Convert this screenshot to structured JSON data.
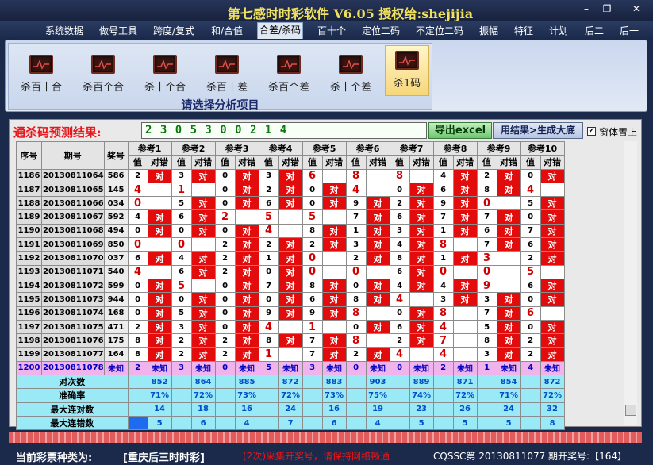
{
  "window": {
    "title": "第七感时时彩软件   V6.05  授权给:shejijia"
  },
  "menu": [
    "系统数据",
    "做号工具",
    "跨度/复式",
    "和/合值",
    "合差/杀码",
    "百十个",
    "定位二码",
    "不定位二码",
    "振幅",
    "特征",
    "计划",
    "后二",
    "后一"
  ],
  "tools": {
    "items": [
      "杀百十合",
      "杀百个合",
      "杀十个合",
      "杀百十差",
      "杀百个差",
      "杀十个差",
      "杀1码"
    ],
    "caption": "请选择分析项目"
  },
  "result": {
    "label": "通杀码预测结果:",
    "value": "2 3 0 5 3 0 0 2 1 4",
    "export_label": "导出excel",
    "generate_label": "用结果>生成大底",
    "topmost_label": "窗体置上"
  },
  "table": {
    "col_headers": [
      "序号",
      "期号",
      "奖号"
    ],
    "ref_headers": [
      "参考1",
      "参考2",
      "参考3",
      "参考4",
      "参考5",
      "参考6",
      "参考7",
      "参考8",
      "参考9",
      "参考10"
    ],
    "sub_headers": [
      "值",
      "对错"
    ],
    "rows": [
      {
        "seq": "1186",
        "period": "20130811064",
        "prize": "586",
        "vals": [
          "2",
          "3",
          "0",
          "3",
          "6",
          "8",
          "8",
          "4",
          "2",
          "0"
        ],
        "marks": [
          "对",
          "对",
          "对",
          "对",
          "",
          "",
          "",
          "对",
          "对",
          "对"
        ]
      },
      {
        "seq": "1187",
        "period": "20130811065",
        "prize": "145",
        "vals": [
          "4",
          "1",
          "0",
          "2",
          "0",
          "4",
          "0",
          "6",
          "8",
          "4"
        ],
        "marks": [
          "",
          "",
          "对",
          "对",
          "对",
          "",
          "对",
          "对",
          "对",
          ""
        ]
      },
      {
        "seq": "1188",
        "period": "20130811066",
        "prize": "034",
        "vals": [
          "0",
          "5",
          "0",
          "6",
          "0",
          "9",
          "2",
          "9",
          "0",
          "5"
        ],
        "marks": [
          "",
          "对",
          "对",
          "对",
          "对",
          "对",
          "对",
          "对",
          "",
          "对"
        ]
      },
      {
        "seq": "1189",
        "period": "20130811067",
        "prize": "592",
        "vals": [
          "4",
          "6",
          "2",
          "5",
          "5",
          "7",
          "6",
          "7",
          "7",
          "0"
        ],
        "marks": [
          "对",
          "对",
          "",
          "",
          "",
          "对",
          "对",
          "对",
          "对",
          "对"
        ]
      },
      {
        "seq": "1190",
        "period": "20130811068",
        "prize": "494",
        "vals": [
          "0",
          "0",
          "0",
          "4",
          "8",
          "1",
          "3",
          "1",
          "6",
          "7"
        ],
        "marks": [
          "对",
          "对",
          "对",
          "",
          "对",
          "对",
          "对",
          "对",
          "对",
          "对"
        ]
      },
      {
        "seq": "1191",
        "period": "20130811069",
        "prize": "850",
        "vals": [
          "0",
          "0",
          "2",
          "2",
          "2",
          "3",
          "4",
          "8",
          "7",
          "6"
        ],
        "marks": [
          "",
          "",
          "对",
          "对",
          "对",
          "对",
          "对",
          "",
          "对",
          "对"
        ]
      },
      {
        "seq": "1192",
        "period": "20130811070",
        "prize": "037",
        "vals": [
          "6",
          "4",
          "2",
          "1",
          "0",
          "2",
          "8",
          "1",
          "3",
          "2"
        ],
        "marks": [
          "对",
          "对",
          "对",
          "对",
          "",
          "对",
          "对",
          "对",
          "",
          "对"
        ]
      },
      {
        "seq": "1193",
        "period": "20130811071",
        "prize": "540",
        "vals": [
          "4",
          "6",
          "2",
          "0",
          "0",
          "0",
          "6",
          "0",
          "0",
          "5"
        ],
        "marks": [
          "",
          "对",
          "对",
          "对",
          "",
          "",
          "对",
          "",
          "",
          ""
        ]
      },
      {
        "seq": "1194",
        "period": "20130811072",
        "prize": "599",
        "vals": [
          "0",
          "5",
          "0",
          "7",
          "8",
          "0",
          "4",
          "4",
          "9",
          "6"
        ],
        "marks": [
          "对",
          "",
          "对",
          "对",
          "对",
          "对",
          "对",
          "对",
          "",
          "对"
        ]
      },
      {
        "seq": "1195",
        "period": "20130811073",
        "prize": "944",
        "vals": [
          "0",
          "0",
          "0",
          "0",
          "6",
          "8",
          "4",
          "3",
          "3",
          "0"
        ],
        "marks": [
          "对",
          "对",
          "对",
          "对",
          "对",
          "对",
          "",
          "对",
          "对",
          "对"
        ]
      },
      {
        "seq": "1196",
        "period": "20130811074",
        "prize": "168",
        "vals": [
          "0",
          "5",
          "0",
          "9",
          "9",
          "8",
          "0",
          "8",
          "7",
          "6"
        ],
        "marks": [
          "对",
          "对",
          "对",
          "对",
          "对",
          "",
          "对",
          "",
          "对",
          ""
        ]
      },
      {
        "seq": "1197",
        "period": "20130811075",
        "prize": "471",
        "vals": [
          "2",
          "3",
          "0",
          "4",
          "1",
          "0",
          "6",
          "4",
          "5",
          "0"
        ],
        "marks": [
          "对",
          "对",
          "对",
          "",
          "",
          "对",
          "对",
          "",
          "对",
          "对"
        ]
      },
      {
        "seq": "1198",
        "period": "20130811076",
        "prize": "175",
        "prize_note": "",
        "vals": [
          "8",
          "2",
          "2",
          "8",
          "7",
          "8",
          "2",
          "7",
          "8",
          "2"
        ],
        "marks": [
          "对",
          "对",
          "对",
          "对",
          "对",
          "",
          "对",
          "",
          "对",
          "对"
        ]
      },
      {
        "seq": "1199",
        "period": "20130811077",
        "prize": "164",
        "vals": [
          "8",
          "2",
          "2",
          "1",
          "7",
          "2",
          "4",
          "4",
          "3",
          "2"
        ],
        "marks": [
          "对",
          "对",
          "对",
          "",
          "对",
          "对",
          "",
          "",
          "对",
          "对"
        ]
      },
      {
        "seq": "1200",
        "period": "20130811078",
        "prize": "未知",
        "vals": [
          "2",
          "3",
          "0",
          "5",
          "3",
          "0",
          "0",
          "2",
          "1",
          "4"
        ],
        "marks": [
          "未知",
          "未知",
          "未知",
          "未知",
          "未知",
          "未知",
          "未知",
          "未知",
          "未知",
          "未知"
        ]
      }
    ],
    "stats": [
      {
        "label": "对次数",
        "values": [
          "852",
          "864",
          "885",
          "872",
          "883",
          "903",
          "889",
          "871",
          "854",
          "872"
        ]
      },
      {
        "label": "准确率",
        "values": [
          "71%",
          "72%",
          "73%",
          "72%",
          "73%",
          "75%",
          "74%",
          "72%",
          "71%",
          "72%"
        ]
      },
      {
        "label": "最大连对数",
        "values": [
          "14",
          "18",
          "16",
          "24",
          "16",
          "19",
          "23",
          "26",
          "24",
          "32"
        ]
      },
      {
        "label": "最大连错数",
        "values": [
          "5",
          "6",
          "4",
          "7",
          "6",
          "4",
          "5",
          "5",
          "5",
          "8"
        ]
      }
    ]
  },
  "status": {
    "lottery_label": "当前彩票种类为:",
    "lottery_value": "[重庆后三时时彩]",
    "notice": "(2次)采集开奖号，请保持网络畅通",
    "draw_info": "CQSSC第 20130811077 期开奖号:【164】"
  },
  "colors": {
    "hit": "#e20c0c",
    "title": "#f0e060",
    "accent_red": "#e8161b",
    "stats_bg": "#9ae9f7",
    "pending_bg": "#f1b3ec"
  }
}
